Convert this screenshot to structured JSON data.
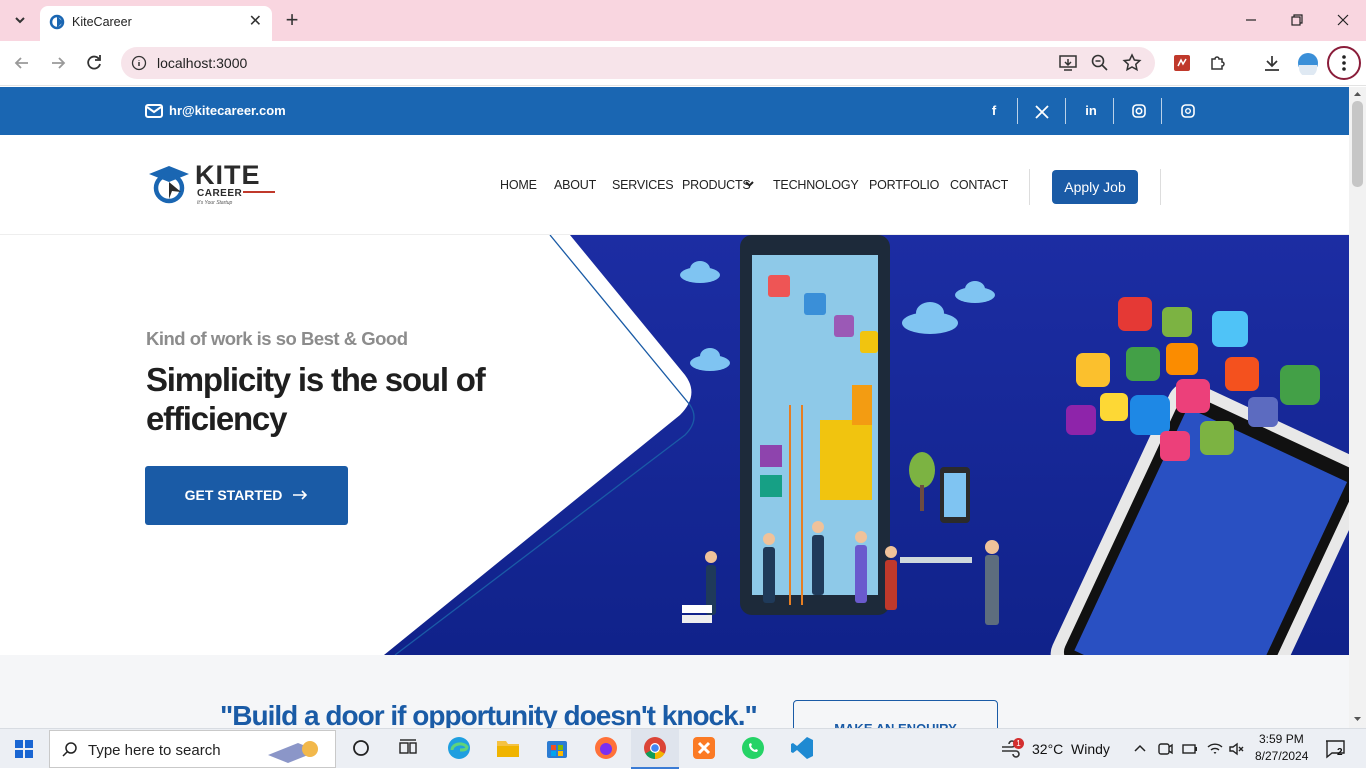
{
  "browser": {
    "tab_title": "KiteCareer",
    "new_tab": "+",
    "url": "localhost:3000",
    "window_controls": [
      "minimize",
      "restore",
      "close"
    ]
  },
  "site": {
    "email": "hr@kitecareer.com",
    "social": [
      "f",
      "X",
      "in",
      "instagram",
      "threads"
    ],
    "logo_main": "KITE",
    "logo_sub": "CAREER",
    "logo_tagline": "It's Your Startup",
    "nav": [
      "HOME",
      "ABOUT",
      "SERVICES",
      "PRODUCTS",
      "TECHNOLOGY",
      "PORTFOLIO",
      "CONTACT"
    ],
    "apply_label": "Apply Job",
    "hero": {
      "kicker": "Kind of work is so Best & Good",
      "headline": "Simplicity is the soul of efficiency",
      "cta": "GET STARTED"
    },
    "quote": "\"Build a door if opportunity doesn't knock.\"",
    "enquiry": "MAKE AN ENQUIRY"
  },
  "taskbar": {
    "search_placeholder": "Type here to search",
    "weather_temp": "32°C",
    "weather_desc": "Windy",
    "weather_badge": "1",
    "time": "3:59 PM",
    "date": "8/27/2024",
    "notifications": "2"
  },
  "colors": {
    "brand_blue": "#1a5ba6",
    "topbar_blue": "#1a66b2",
    "hero_bg": "#1a2fa0",
    "tab_strip": "#f9d6e0"
  }
}
